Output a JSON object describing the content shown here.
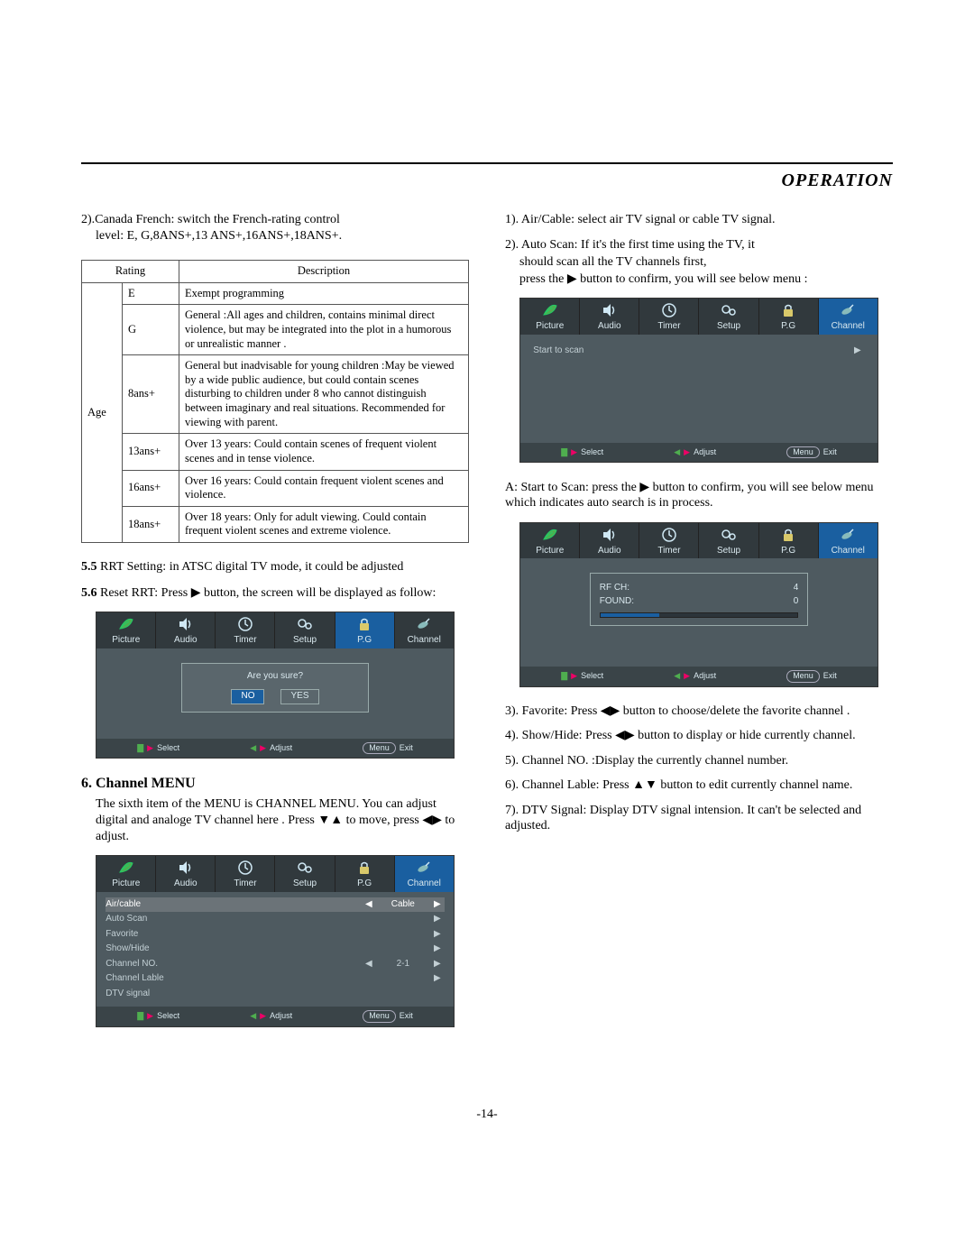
{
  "header": {
    "title": "OPERATION"
  },
  "left": {
    "intro1": "2).Canada French: switch the French-rating control",
    "intro2": "level: E, G,8ANS+,13 ANS+,16ANS+,18ANS+.",
    "table": {
      "h1": "Rating",
      "h2": "Description",
      "ageLabel": "Age",
      "rows": [
        {
          "r": "E",
          "d": "Exempt programming"
        },
        {
          "r": "G",
          "d": "General :All ages and children, contains minimal direct violence, but may be integrated into the plot in a humorous or unrealistic manner ."
        },
        {
          "r": "8ans+",
          "d": "General but inadvisable for young children :May be viewed by a wide public audience, but could contain scenes disturbing to children under 8 who cannot distinguish between imaginary and real situations. Recommended for viewing with parent."
        },
        {
          "r": "13ans+",
          "d": "Over 13 years: Could contain scenes of frequent violent scenes and in tense violence."
        },
        {
          "r": "16ans+",
          "d": "Over 16 years: Could contain frequent violent scenes and violence."
        },
        {
          "r": "18ans+",
          "d": "Over 18 years: Only for adult viewing. Could contain frequent violent  scenes and extreme violence."
        }
      ]
    },
    "s55a": "5.5",
    "s55b": " RRT Setting: in ATSC digital TV mode, it could be adjusted",
    "s56a": "5.6",
    "s56b": " Reset RRT: Press  ",
    "s56c": "  button, the screen will be displayed as follow:",
    "osd1": {
      "prompt": "Are you sure?",
      "no": "NO",
      "yes": "YES"
    },
    "h6": "6. Channel  MENU",
    "ch_p1": "The sixth item of the MENU is CHANNEL MENU. You can adjust digital and analoge TV channel here . Press ",
    "ch_p2": "   to move, press ",
    "ch_p3": "   to adjust.",
    "chmenu": {
      "rows": [
        {
          "lbl": "Air/cable",
          "val": "Cable",
          "sel": true,
          "lar": true,
          "rar": true
        },
        {
          "lbl": "Auto Scan",
          "val": "",
          "sel": false,
          "lar": false,
          "rar": true
        },
        {
          "lbl": "Favorite",
          "val": "",
          "sel": false,
          "lar": false,
          "rar": true
        },
        {
          "lbl": "Show/Hide",
          "val": "",
          "sel": false,
          "lar": false,
          "rar": true
        },
        {
          "lbl": "Channel NO.",
          "val": "2-1",
          "sel": false,
          "lar": true,
          "rar": true
        },
        {
          "lbl": "Channel Lable",
          "val": "",
          "sel": false,
          "lar": false,
          "rar": true
        },
        {
          "lbl": "DTV signal",
          "val": "",
          "sel": false,
          "lar": false,
          "rar": false
        }
      ]
    }
  },
  "right": {
    "l1": "1). Air/Cable: select air  TV signal or  cable  TV signal.",
    "l2a": "2). Auto Scan: If it's the first time  using the TV, it",
    "l2b": "should scan all the TV channels first,",
    "l2c": "press the ",
    "l2d": " button  to confirm,  you will see below menu :",
    "start_scan": "Start to scan",
    "a1": "A: Start to Scan: press the ",
    "a2": "  button  to confirm,  you will see below menu which indicates auto search is in process.",
    "scan": {
      "rf_l": "RF  CH:",
      "rf_v": "4",
      "found_l": "FOUND:",
      "found_v": "0"
    },
    "l3": "3). Favorite: Press ◀▶ button to choose/delete the favorite channel .",
    "l4": "4). Show/Hide: Press ◀▶ button to display  or hide currently channel.",
    "l5": "5). Channel NO.  :Display  the currently channel number.",
    "l6": "6). Channel Lable: Press ▲▼  button to edit currently channel name.",
    "l7": "7). DTV Signal: Display DTV signal intension. It can't be selected and adjusted."
  },
  "tabs": [
    {
      "label": "Picture",
      "icon": "leaf"
    },
    {
      "label": "Audio",
      "icon": "speaker"
    },
    {
      "label": "Timer",
      "icon": "clock"
    },
    {
      "label": "Setup",
      "icon": "gears"
    },
    {
      "label": "P.G",
      "icon": "lock"
    },
    {
      "label": "Channel",
      "icon": "sat"
    }
  ],
  "footer": {
    "select": "Select",
    "adjust": "Adjust",
    "menu": "Menu",
    "exit": "Exit"
  },
  "arrows": {
    "right": "▶",
    "left": "◀",
    "up": "▲",
    "down": "▼",
    "du": "▼▲",
    "lr": "◀▶"
  },
  "pageNum": "-14-"
}
